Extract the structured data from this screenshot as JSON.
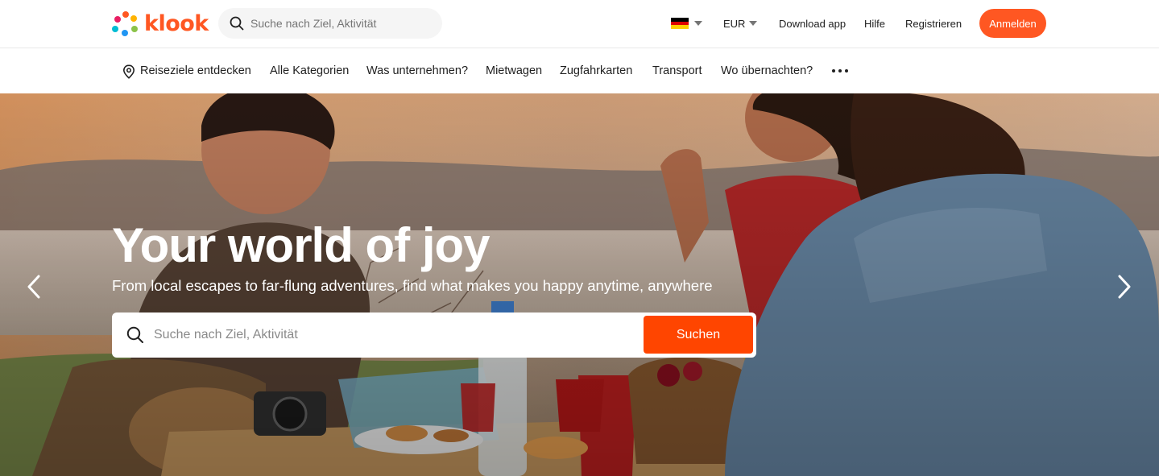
{
  "header": {
    "logo_text": "klook",
    "search_placeholder": "Suche nach Ziel, Aktivität",
    "language_flag": "germany-flag-icon",
    "currency": "EUR",
    "download_app": "Download app",
    "help": "Hilfe",
    "register": "Registrieren",
    "login": "Anmelden"
  },
  "nav": {
    "items": [
      "Reiseziele entdecken",
      "Alle Kategorien",
      "Was unternehmen?",
      "Mietwagen",
      "Zugfahrkarten",
      "Transport",
      "Wo übernachten?"
    ],
    "more_icon": "more-dots-icon"
  },
  "hero": {
    "title": "Your world of joy",
    "subtitle": "From local escapes to far-flung adventures, find what makes you happy anytime, anywhere",
    "search_placeholder": "Suche nach Ziel, Aktivität",
    "search_button": "Suchen"
  },
  "colors": {
    "brand": "#ff5722",
    "search_button": "#ff4500"
  }
}
